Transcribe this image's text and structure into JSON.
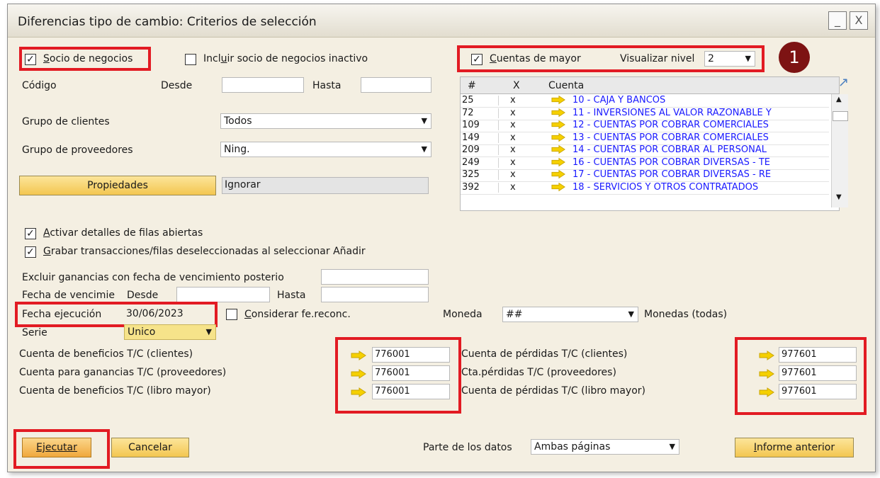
{
  "window": {
    "title": "Diferencias tipo de cambio: Criterios de selección",
    "minimize": "_",
    "close": "X"
  },
  "bp": {
    "socio_label_u": "S",
    "socio_label_rest": "ocio de negocios",
    "inactive_label_pre": "Incl",
    "inactive_label_u": "u",
    "inactive_label_rest": "ir socio de negocios inactivo",
    "codigo_label": "Código",
    "desde_label": "Desde",
    "hasta_label": "Hasta",
    "desde_value": "",
    "hasta_value": "",
    "grupo_clientes_label": "Grupo de clientes",
    "grupo_clientes_value": "Todos",
    "grupo_proveedores_label": "Grupo de proveedores",
    "grupo_proveedores_value": "Ning.",
    "propiedades_label": "Propiedades",
    "propiedades_value": "Ignorar"
  },
  "gl": {
    "cuentas_label_u": "C",
    "cuentas_label_rest": "uentas de mayor",
    "nivel_label": "Visualizar nivel",
    "nivel_value": "2",
    "columns": [
      "#",
      "X",
      "Cuenta"
    ],
    "rows": [
      {
        "num": "25",
        "x": "x",
        "cuenta": "10 - CAJA Y BANCOS"
      },
      {
        "num": "72",
        "x": "x",
        "cuenta": "11 - INVERSIONES AL VALOR RAZONABLE Y"
      },
      {
        "num": "109",
        "x": "x",
        "cuenta": "12 - CUENTAS POR COBRAR COMERCIALES"
      },
      {
        "num": "149",
        "x": "x",
        "cuenta": "13 - CUENTAS POR COBRAR COMERCIALES"
      },
      {
        "num": "209",
        "x": "x",
        "cuenta": "14 - CUENTAS POR COBRAR AL PERSONAL"
      },
      {
        "num": "249",
        "x": "x",
        "cuenta": "16 - CUENTAS POR COBRAR DIVERSAS - TE"
      },
      {
        "num": "325",
        "x": "x",
        "cuenta": "17 - CUENTAS POR COBRAR DIVERSAS - RE"
      },
      {
        "num": "392",
        "x": "x",
        "cuenta": "18 - SERVICIOS Y OTROS CONTRATADOS"
      }
    ]
  },
  "options": {
    "activar_u": "A",
    "activar_rest": "ctivar detalles de filas abiertas",
    "grabar_u": "G",
    "grabar_rest": "rabar transacciones/filas deseleccionadas al seleccionar Añadir",
    "excluir_label": "Excluir ganancias con fecha de vencimiento posterio",
    "excluir_value": "",
    "fecha_venc_label": "Fecha de vencimie",
    "fecha_venc_desde": "Desde",
    "fecha_venc_hasta": "Hasta",
    "fecha_ejec_label": "Fecha ejecución",
    "fecha_ejec_value": "30/06/2023",
    "considerar_u": "C",
    "considerar_rest": "onsiderar fe.reconc.",
    "moneda_label": "Moneda",
    "moneda_value": "##",
    "moneda_desc": "Monedas (todas)",
    "serie_label": "Serie",
    "serie_value": "Unico"
  },
  "accounts": {
    "ben_clientes_label": "Cuenta de beneficios T/C (clientes)",
    "ben_clientes_value": "776001",
    "gan_prov_label": "Cuenta para ganancias T/C (proveedores)",
    "gan_prov_value": "776001",
    "ben_libro_label": "Cuenta de beneficios T/C (libro mayor)",
    "ben_libro_value": "776001",
    "per_clientes_label": "Cuenta de pérdidas T/C (clientes)",
    "per_clientes_value": "977601",
    "per_prov_label": "Cta.pérdidas T/C (proveedores)",
    "per_prov_value": "977601",
    "per_libro_label": "Cuenta de pérdidas T/C (libro mayor)",
    "per_libro_value": "977601"
  },
  "footer": {
    "ejecutar": "Ejecutar",
    "cancelar": "Cancelar",
    "parte_label": "Parte de los datos",
    "parte_value": "Ambas páginas",
    "informe_u": "I",
    "informe_rest": "nforme anterior"
  },
  "badge": "1",
  "colors": {
    "accent_red": "#e21b23",
    "badge": "#7d1313",
    "link_blue": "#1a1aff",
    "button_yellow": "#f3c650",
    "arrow_yellow": "#f5d000"
  }
}
